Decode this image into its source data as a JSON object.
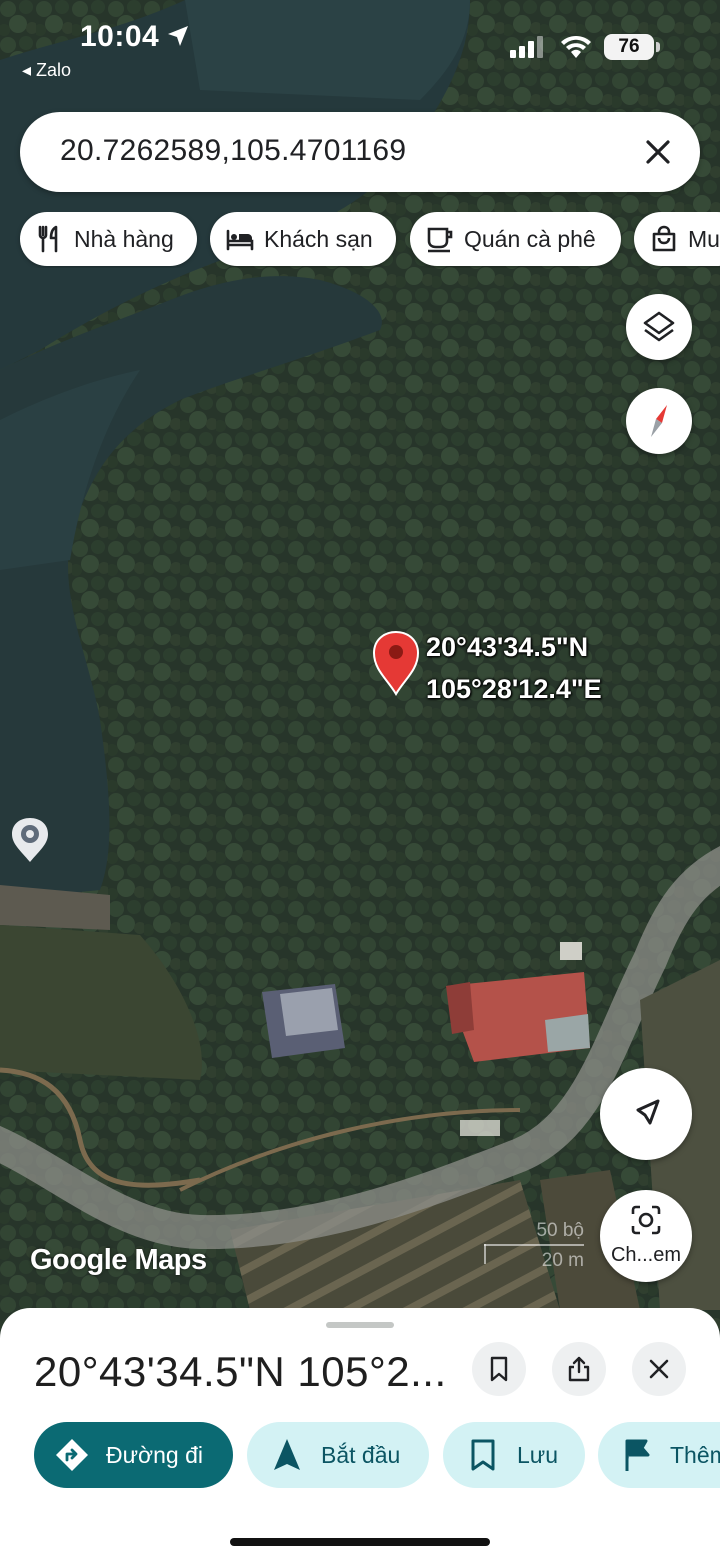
{
  "status_bar": {
    "time": "10:04",
    "back_app": "◂ Zalo",
    "battery": "76"
  },
  "search": {
    "query": "20.7262589,105.4701169"
  },
  "chips": [
    {
      "label": "Nhà hàng",
      "icon": "restaurant-icon"
    },
    {
      "label": "Khách sạn",
      "icon": "hotel-icon"
    },
    {
      "label": "Quán cà phê",
      "icon": "coffee-icon"
    },
    {
      "label": "Mu",
      "icon": "shopping-bag-icon"
    }
  ],
  "map": {
    "pin_lat": "20°43'34.5\"N",
    "pin_lng": "105°28'12.4\"E",
    "logo": "Google Maps",
    "scale_imperial": "50 bộ",
    "scale_metric": "20 m",
    "camera_button_label": "Ch...em",
    "pin_color": "#e53935"
  },
  "sheet": {
    "title": "20°43'34.5\"N 105°2...",
    "actions": [
      {
        "label": "Đường đi",
        "icon": "directions-icon",
        "primary": true
      },
      {
        "label": "Bắt đầu",
        "icon": "navigation-arrow-icon",
        "primary": false
      },
      {
        "label": "Lưu",
        "icon": "bookmark-icon",
        "primary": false
      },
      {
        "label": "Thêm",
        "icon": "flag-icon",
        "primary": false
      }
    ],
    "accent_color": "#0b6a73",
    "secondary_color": "#d3f2f4"
  }
}
